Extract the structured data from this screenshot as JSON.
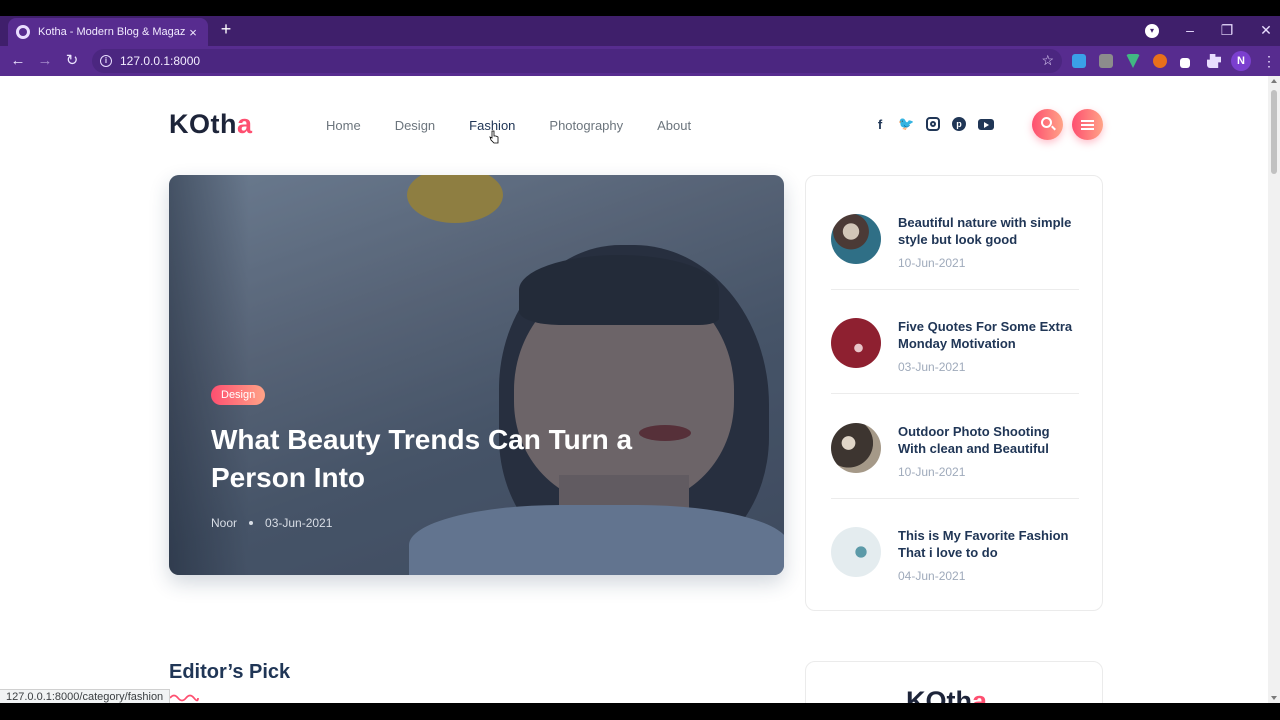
{
  "browser": {
    "tab_title": "Kotha - Modern Blog & Magazine",
    "tab_close": "×",
    "new_tab": "+",
    "url": "127.0.0.1:8000",
    "profile_initial": "N",
    "status_url": "127.0.0.1:8000/category/fashion"
  },
  "site": {
    "logo_main": "KOth",
    "logo_accent": "a",
    "nav": [
      "Home",
      "Design",
      "Fashion",
      "Photography",
      "About"
    ],
    "hovered_nav": "Fashion"
  },
  "hero": {
    "category": "Design",
    "title": "What Beauty Trends Can Turn a Person Into",
    "author": "Noor",
    "date": "03-Jun-2021"
  },
  "sidebar_posts": [
    {
      "title": "Beautiful nature with simple style but look good",
      "date": "10-Jun-2021"
    },
    {
      "title": "Five Quotes For Some Extra Monday Motivation",
      "date": "03-Jun-2021"
    },
    {
      "title": "Outdoor Photo Shooting With clean and Beautiful",
      "date": "10-Jun-2021"
    },
    {
      "title": "This is My Favorite Fashion That i love to do",
      "date": "04-Jun-2021"
    }
  ],
  "section": {
    "editors_pick": "Editor’s Pick"
  },
  "colors": {
    "accent": "#fe4f70",
    "heading": "#203656",
    "browser_frame": "#572c8f"
  }
}
